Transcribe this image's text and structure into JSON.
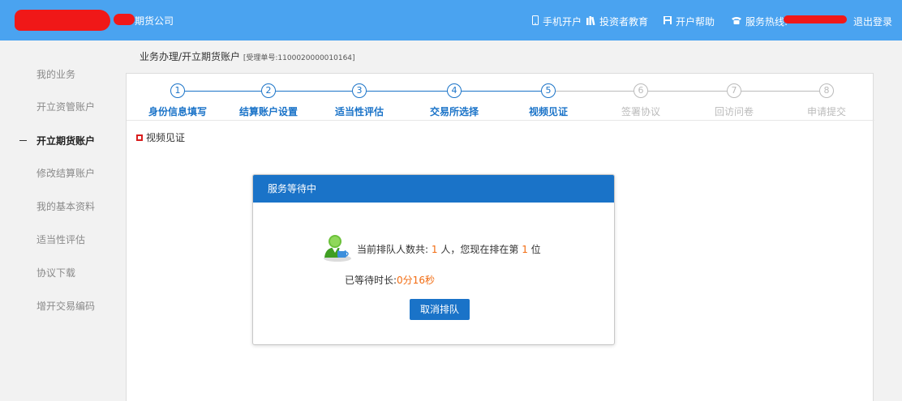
{
  "header": {
    "company": "期货公司",
    "nav": [
      {
        "icon": "phone-icon",
        "label": "手机开户"
      },
      {
        "icon": "books-icon",
        "label": "投资者教育"
      },
      {
        "icon": "save-icon",
        "label": "开户帮助"
      },
      {
        "icon": "telephone-icon",
        "label": "服务热线:"
      }
    ],
    "logout": "退出登录",
    "bg_color": "#4aa3f0"
  },
  "sidebar": {
    "items": [
      {
        "label": "我的业务"
      },
      {
        "label": "开立资管账户"
      },
      {
        "label": "开立期货账户",
        "active": true
      },
      {
        "label": "修改结算账户"
      },
      {
        "label": "我的基本资料"
      },
      {
        "label": "适当性评估"
      },
      {
        "label": "协议下载"
      },
      {
        "label": "增开交易编码"
      }
    ]
  },
  "breadcrumb": {
    "path": "业务办理/开立期货账户",
    "ticket": "[受理单号:1100020000010164]"
  },
  "steps": [
    {
      "num": "1",
      "label": "身份信息填写",
      "done": true
    },
    {
      "num": "2",
      "label": "结算账户设置",
      "done": true
    },
    {
      "num": "3",
      "label": "适当性评估",
      "done": true
    },
    {
      "num": "4",
      "label": "交易所选择",
      "done": true
    },
    {
      "num": "5",
      "label": "视频见证",
      "done": true
    },
    {
      "num": "6",
      "label": "签署协议",
      "done": false
    },
    {
      "num": "7",
      "label": "回访问卷",
      "done": false
    },
    {
      "num": "8",
      "label": "申请提交",
      "done": false
    }
  ],
  "section": {
    "title": "视频见证"
  },
  "dialog": {
    "title": "服务等待中",
    "queue_prefix": "当前排队人数共:",
    "queue_count": "1",
    "queue_mid": "人，您现在排在第",
    "queue_position": "1",
    "queue_suffix": "位",
    "wait_label": "已等待时长:",
    "wait_time": "0分16秒",
    "cancel_label": "取消排队"
  },
  "colors": {
    "accent": "#1a73c8",
    "orange": "#f26b10",
    "redact": "#f01818"
  }
}
